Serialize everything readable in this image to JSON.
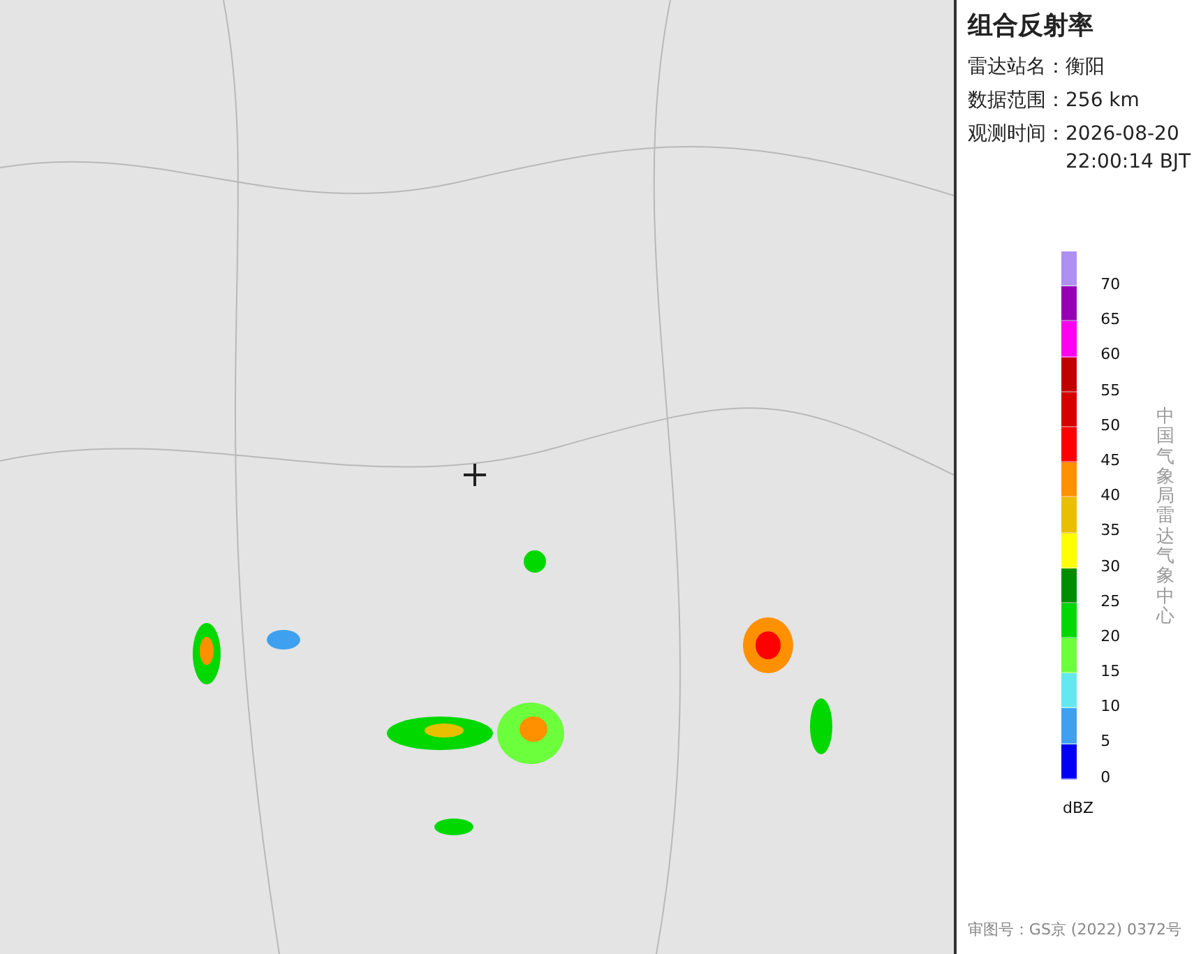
{
  "panel": {
    "title": "组合反射率",
    "fields": [
      {
        "label": "雷达站名：",
        "value": "衡阳"
      },
      {
        "label": "数据范围：",
        "value": "256 km"
      },
      {
        "label": "观测时间：",
        "value": "2026-08-20\n22:00:14 BJT"
      }
    ],
    "legend": {
      "unit": "dBZ",
      "bins": [
        {
          "label": "70",
          "color": "#ad90f0"
        },
        {
          "label": "65",
          "color": "#9600b4"
        },
        {
          "label": "60",
          "color": "#ff00f0"
        },
        {
          "label": "55",
          "color": "#c00000"
        },
        {
          "label": "50",
          "color": "#d60000"
        },
        {
          "label": "45",
          "color": "#ff0000"
        },
        {
          "label": "40",
          "color": "#ff9000"
        },
        {
          "label": "35",
          "color": "#e8c000"
        },
        {
          "label": "30",
          "color": "#ffff00"
        },
        {
          "label": "25",
          "color": "#008c00"
        },
        {
          "label": "20",
          "color": "#00d800"
        },
        {
          "label": "15",
          "color": "#6cff3c"
        },
        {
          "label": "10",
          "color": "#64e8f0"
        },
        {
          "label": "5",
          "color": "#40a0f0"
        },
        {
          "label": "0",
          "color": "#0000f6"
        }
      ]
    },
    "credit": "中国气象局雷达气象中心",
    "footer": "审图号：GS京 (2022) 0372号"
  }
}
